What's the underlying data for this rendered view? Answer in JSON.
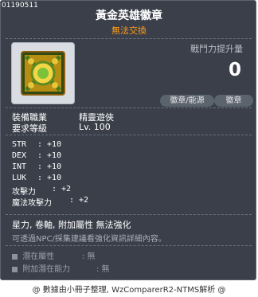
{
  "item": {
    "id": "01190511",
    "name": "黃金英雄徽章",
    "trade": "無法交換",
    "power_label": "戰鬥力提升量",
    "power_value": "0",
    "tags": [
      "徽章/能源",
      "徽章"
    ],
    "requirements": [
      {
        "key": "裝備職業",
        "value": "精靈遊俠"
      },
      {
        "key": "要求等級",
        "value": "Lv. 100"
      }
    ],
    "stats": [
      {
        "name": "STR",
        "value": ": +10"
      },
      {
        "name": "DEX",
        "value": ": +10"
      },
      {
        "name": "INT",
        "value": ": +10"
      },
      {
        "name": "LUK",
        "value": ": +10"
      },
      {
        "name": "攻擊力",
        "value": ": +2"
      },
      {
        "name": "魔法攻擊力",
        "value": ": +2"
      }
    ],
    "flags": "星力, 卷軸, 附加屬性 無法強化",
    "note": "可透過NPC/採集建議看強化資訊詳細內容。",
    "potential": {
      "label": "潛在屬性",
      "value": ": 無"
    },
    "additional_potential": {
      "label": "附加潛在能力",
      "value": ": 無"
    }
  },
  "footer": "@ 數據由小冊子整理, WzComparerR2-NTMS解析 @",
  "colors": {
    "panel": "#3a3f49",
    "trade": "#ff9b17",
    "text": "#ffffff",
    "muted": "#aab0b9"
  },
  "icons": {
    "item": "gold-hero-emblem-icon",
    "checkbox": "potential-box-icon"
  }
}
